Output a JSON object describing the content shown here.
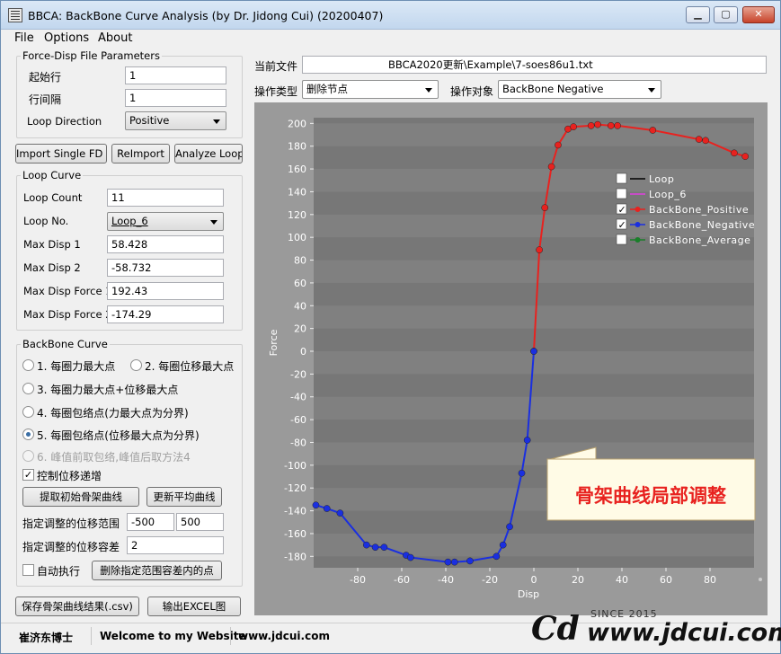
{
  "window": {
    "title": "BBCA: BackBone Curve Analysis (by Dr. Jidong Cui) (20200407)",
    "min": "▁",
    "max": "▢",
    "close": "✕"
  },
  "menu": [
    "File",
    "Options",
    "About"
  ],
  "fd_params": {
    "title": "Force-Disp File Parameters",
    "start_row_label": "起始行",
    "start_row": "1",
    "row_interval_label": "行间隔",
    "row_interval": "1",
    "loop_direction_label": "Loop Direction",
    "loop_direction": "Positive"
  },
  "buttons": {
    "import": "Import Single FD File",
    "reimport": "ReImport",
    "analyze": "Analyze Loop",
    "extract": "提取初始骨架曲线",
    "update_avg": "更新平均曲线",
    "delete_points": "删除指定范围容差内的点",
    "save_csv": "保存骨架曲线结果(.csv)",
    "export_excel": "输出EXCEL图"
  },
  "loop_curve": {
    "title": "Loop Curve",
    "loop_count_label": "Loop Count",
    "loop_count": "11",
    "loop_no_label": "Loop No.",
    "loop_no": "Loop_6",
    "max_disp1_label": "Max Disp 1",
    "max_disp1": "58.428",
    "max_disp2_label": "Max Disp 2",
    "max_disp2": "-58.732",
    "max_force1_label": "Max Disp Force 1",
    "max_force1": "192.43",
    "max_force2_label": "Max Disp Force 2",
    "max_force2": "-174.29"
  },
  "backbone": {
    "title": "BackBone Curve",
    "opt1": "1. 每圈力最大点",
    "opt2": "2. 每圈位移最大点",
    "opt3": "3. 每圈力最大点+位移最大点",
    "opt4": "4. 每圈包络点(力最大点为分界)",
    "opt5": "5. 每圈包络点(位移最大点为分界)",
    "opt6": "6. 峰值前取包络,峰值后取方法4",
    "control_label": "控制位移递增",
    "range_label": "指定调整的位移范围",
    "range_min": "-500",
    "range_max": "500",
    "tol_label": "指定调整的位移容差",
    "tol": "2",
    "auto_label": "自动执行"
  },
  "file": {
    "label": "当前文件",
    "path": "BBCA2020更新\\Example\\7-soes86u1.txt"
  },
  "op": {
    "type_label": "操作类型",
    "type": "删除节点",
    "target_label": "操作对象",
    "target": "BackBone Negative"
  },
  "status": {
    "author": "崔济东博士",
    "welcome": "Welcome to my Website",
    "site": "www.jdcui.com"
  },
  "callout": "骨架曲线局部调整",
  "watermark": {
    "since": "SINCE 2015",
    "url": "www.jdcui.com"
  },
  "colors": {
    "positive": "#e8221f",
    "negative": "#1a2fe0",
    "average": "#1a7f2a",
    "loop": "#000000",
    "loop6": "#e040e0",
    "plot_bg": "#777777"
  },
  "chart_data": {
    "type": "line",
    "xlabel": "Disp",
    "ylabel": "Force",
    "xlim": [
      -100,
      100
    ],
    "ylim": [
      -190,
      205
    ],
    "xticks": [
      -80,
      -60,
      -40,
      -20,
      0,
      20,
      40,
      60,
      80
    ],
    "yticks": [
      -180,
      -160,
      -140,
      -120,
      -100,
      -80,
      -60,
      -40,
      -20,
      0,
      20,
      40,
      60,
      80,
      100,
      120,
      140,
      160,
      180,
      200
    ],
    "legend_position": "top-right",
    "legend": [
      {
        "name": "Loop",
        "checked": false,
        "color": "#000000",
        "marker": false
      },
      {
        "name": "Loop_6",
        "checked": false,
        "color": "#e040e0",
        "marker": false
      },
      {
        "name": "BackBone_Positive",
        "checked": true,
        "color": "#e8221f",
        "marker": true
      },
      {
        "name": "BackBone_Negative",
        "checked": true,
        "color": "#1a2fe0",
        "marker": true
      },
      {
        "name": "BackBone_Average",
        "checked": false,
        "color": "#1a7f2a",
        "marker": true
      }
    ],
    "series": [
      {
        "name": "BackBone_Positive",
        "color": "#e8221f",
        "x": [
          0,
          2.5,
          5,
          8,
          11,
          15.5,
          18,
          26,
          29,
          35,
          38,
          54,
          75,
          78,
          91,
          96
        ],
        "y": [
          0,
          89,
          126,
          162,
          181,
          195,
          197,
          198,
          199,
          198,
          198,
          194,
          186,
          185,
          174,
          171
        ]
      },
      {
        "name": "BackBone_Negative",
        "color": "#1a2fe0",
        "x": [
          -99,
          -94,
          -88,
          -76,
          -72,
          -68,
          -58,
          -56,
          -39,
          -36,
          -29,
          -17,
          -14,
          -11,
          -5.5,
          -3,
          0
        ],
        "y": [
          -135,
          -138,
          -142,
          -170,
          -172,
          -172,
          -179,
          -181,
          -185,
          -185,
          -184,
          -180,
          -170,
          -154,
          -107,
          -78,
          0
        ]
      }
    ]
  }
}
